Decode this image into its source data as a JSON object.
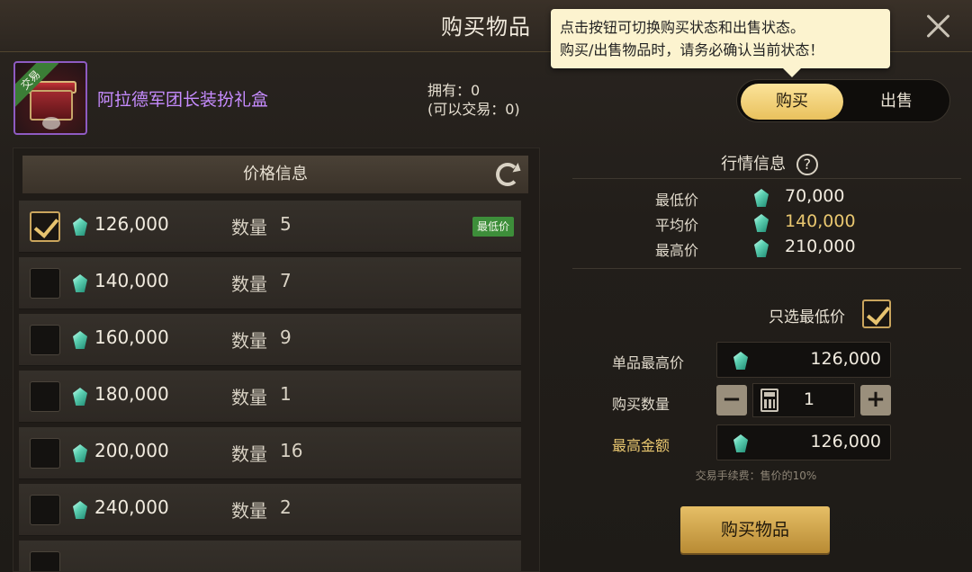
{
  "header": {
    "title": "购买物品"
  },
  "tooltip": {
    "line1": "点击按钮可切换购买状态和出售状态。",
    "line2": "购买/出售物品时，请务必确认当前状态！"
  },
  "item": {
    "name": "阿拉德军团长装扮礼盒",
    "ribbon": "交易",
    "owned": "拥有：0",
    "tradable": "(可以交易：0)"
  },
  "toggle": {
    "buy_label": "购买",
    "sell_label": "出售",
    "active": "buy"
  },
  "price_list": {
    "header": "价格信息",
    "qty_label": "数量",
    "lowest_badge": "最低价",
    "rows": [
      {
        "price": "126,000",
        "qty": "5",
        "checked": true
      },
      {
        "price": "140,000",
        "qty": "7",
        "checked": false
      },
      {
        "price": "160,000",
        "qty": "9",
        "checked": false
      },
      {
        "price": "180,000",
        "qty": "1",
        "checked": false
      },
      {
        "price": "200,000",
        "qty": "16",
        "checked": false
      },
      {
        "price": "240,000",
        "qty": "2",
        "checked": false
      }
    ]
  },
  "market": {
    "title": "行情信息",
    "help": "?",
    "min_label": "最低价",
    "min_value": "70,000",
    "avg_label": "平均价",
    "avg_value": "140,000",
    "max_label": "最高价",
    "max_value": "210,000"
  },
  "form": {
    "only_lowest_label": "只选最低价",
    "unit_max_label": "单品最高价",
    "unit_max_value": "126,000",
    "qty_label": "购买数量",
    "qty_value": "1",
    "total_label": "最高金额",
    "total_value": "126,000",
    "minus": "−",
    "plus": "+",
    "fee_note": "交易手续费：售价的10%",
    "buy_button": "购买物品"
  },
  "colors": {
    "accent_gold": "#e9c770",
    "item_purple": "#c68cff",
    "badge_green": "#3d8e3a"
  }
}
